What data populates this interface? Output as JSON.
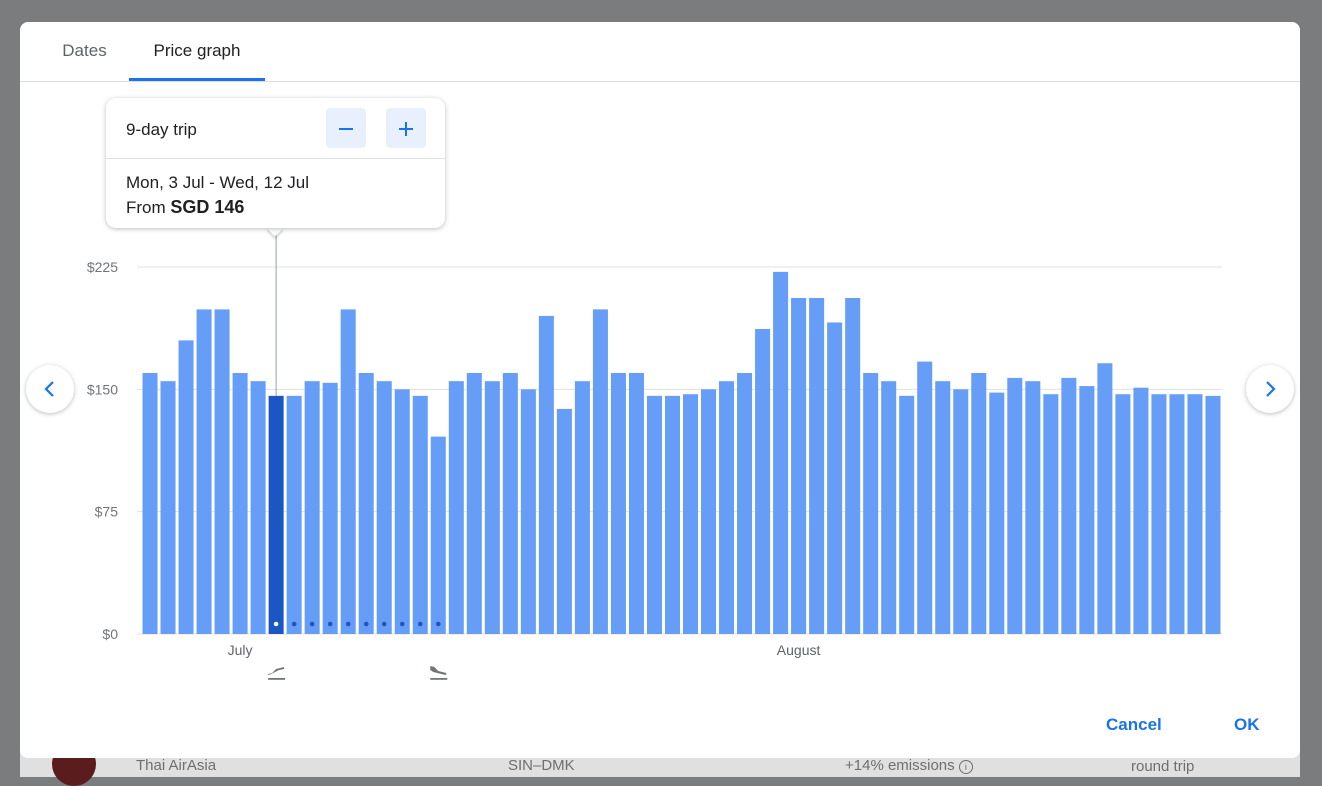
{
  "background": {
    "airline": "Thai AirAsia",
    "route": "SIN–DMK",
    "emissions": "+14% emissions",
    "trip_type": "round trip"
  },
  "tabs": [
    {
      "label": "Dates",
      "active": false
    },
    {
      "label": "Price graph",
      "active": true
    }
  ],
  "popover": {
    "trip_length_label": "9-day trip",
    "decrease_icon": "minus-icon",
    "increase_icon": "plus-icon",
    "date_range": "Mon, 3 Jul - Wed, 12 Jul",
    "price_prefix": "From",
    "price": "SGD 146"
  },
  "nav": {
    "prev_icon": "chevron-left-icon",
    "next_icon": "chevron-right-icon"
  },
  "footer": {
    "cancel_label": "Cancel",
    "ok_label": "OK"
  },
  "colors": {
    "bar": "#669df6",
    "bar_selected": "#1a56c4",
    "accent": "#1a73e8",
    "grid": "#e0e0e0"
  },
  "chart_data": {
    "type": "bar",
    "ylim": [
      0,
      225
    ],
    "yticks": [
      0,
      75,
      150,
      225
    ],
    "ytick_labels": [
      "$0",
      "$75",
      "$150",
      "$225"
    ],
    "month_labels": [
      {
        "label": "July",
        "index": 5
      },
      {
        "label": "August",
        "index": 36
      }
    ],
    "selected_index": 7,
    "trip_dot_indices": [
      7,
      8,
      9,
      10,
      11,
      12,
      13,
      14,
      15,
      16
    ],
    "departure_index": 7,
    "return_index": 16,
    "departure_icon": "flight-takeoff-icon",
    "return_icon": "flight-land-icon",
    "grid": true,
    "values": [
      160,
      155,
      180,
      199,
      199,
      160,
      155,
      146,
      146,
      155,
      154,
      199,
      160,
      155,
      150,
      146,
      121,
      155,
      160,
      155,
      160,
      150,
      195,
      138,
      155,
      199,
      160,
      160,
      146,
      146,
      147,
      150,
      155,
      160,
      187,
      222,
      206,
      206,
      191,
      206,
      160,
      155,
      146,
      167,
      155,
      150,
      160,
      148,
      157,
      155,
      147,
      157,
      152,
      166,
      147,
      151,
      147,
      147,
      147,
      146
    ]
  }
}
